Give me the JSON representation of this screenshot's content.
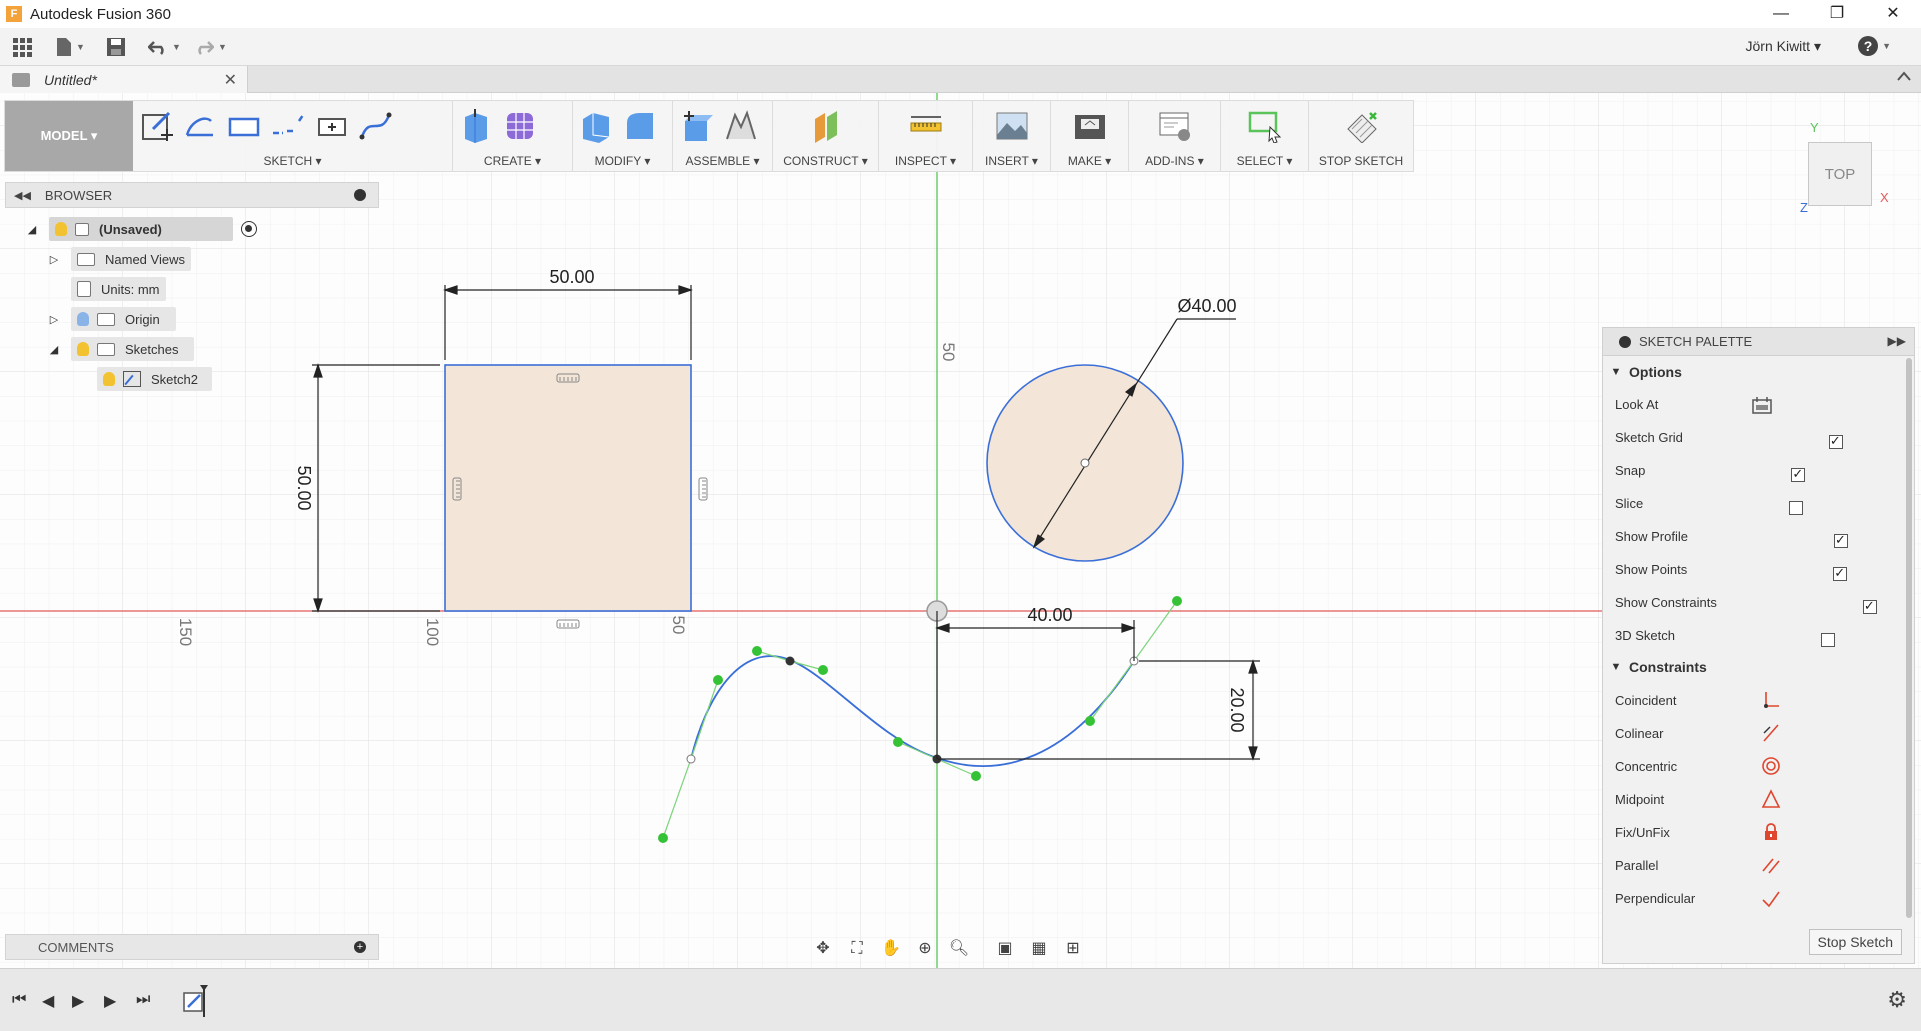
{
  "window": {
    "title": "Autodesk Fusion 360",
    "app_icon": "F",
    "minimize": "—",
    "restore": "❐",
    "close": "✕"
  },
  "qat": {
    "user": "Jörn Kiwitt ▾"
  },
  "tab": {
    "name": "Untitled*",
    "close": "✕"
  },
  "toolbar": {
    "workspace": "MODEL ▾",
    "groups": [
      "SKETCH ▾",
      "CREATE ▾",
      "MODIFY ▾",
      "ASSEMBLE ▾",
      "CONSTRUCT ▾",
      "INSPECT ▾",
      "INSERT ▾",
      "MAKE ▾",
      "ADD-INS ▾",
      "SELECT ▾",
      "STOP SKETCH"
    ]
  },
  "browser": {
    "title": "BROWSER",
    "items": [
      {
        "label": "(Unsaved)"
      },
      {
        "label": "Named Views"
      },
      {
        "label": "Units: mm"
      },
      {
        "label": "Origin"
      },
      {
        "label": "Sketches"
      },
      {
        "label": "Sketch2"
      }
    ]
  },
  "comments": {
    "title": "COMMENTS"
  },
  "sketch": {
    "dim_rect_width": "50.00",
    "dim_rect_height": "50.00",
    "dim_circle_diameter": "Ø40.00",
    "dim_spline_x": "40.00",
    "dim_spline_y": "20.00",
    "grid_label_150": "150",
    "grid_label_100": "100",
    "grid_label_50h": "50",
    "grid_label_50v": "50"
  },
  "viewcube": {
    "face": "TOP",
    "x": "X",
    "y": "Y",
    "z": "Z"
  },
  "palette": {
    "title": "SKETCH PALETTE",
    "options_title": "Options",
    "options": [
      {
        "label": "Look At",
        "control": "icon"
      },
      {
        "label": "Sketch Grid",
        "checked": true
      },
      {
        "label": "Snap",
        "checked": true
      },
      {
        "label": "Slice",
        "checked": false
      },
      {
        "label": "Show Profile",
        "checked": true
      },
      {
        "label": "Show Points",
        "checked": true
      },
      {
        "label": "Show Constraints",
        "checked": true
      },
      {
        "label": "3D Sketch",
        "checked": false
      }
    ],
    "constraints_title": "Constraints",
    "constraints": [
      {
        "label": "Coincident",
        "icon": "coincident-icon"
      },
      {
        "label": "Colinear",
        "icon": "colinear-icon"
      },
      {
        "label": "Concentric",
        "icon": "concentric-icon"
      },
      {
        "label": "Midpoint",
        "icon": "midpoint-icon"
      },
      {
        "label": "Fix/UnFix",
        "icon": "lock-icon"
      },
      {
        "label": "Parallel",
        "icon": "parallel-icon"
      },
      {
        "label": "Perpendicular",
        "icon": "perpendicular-icon"
      }
    ],
    "stop_button": "Stop Sketch"
  },
  "colors": {
    "profile_fill": "#f3e6d8",
    "sketch_line": "#3b6fd8",
    "x_axis": "#e45a5a",
    "y_axis": "#5ac45a",
    "constraint_red": "#e0452e",
    "point_green": "#36c236"
  }
}
